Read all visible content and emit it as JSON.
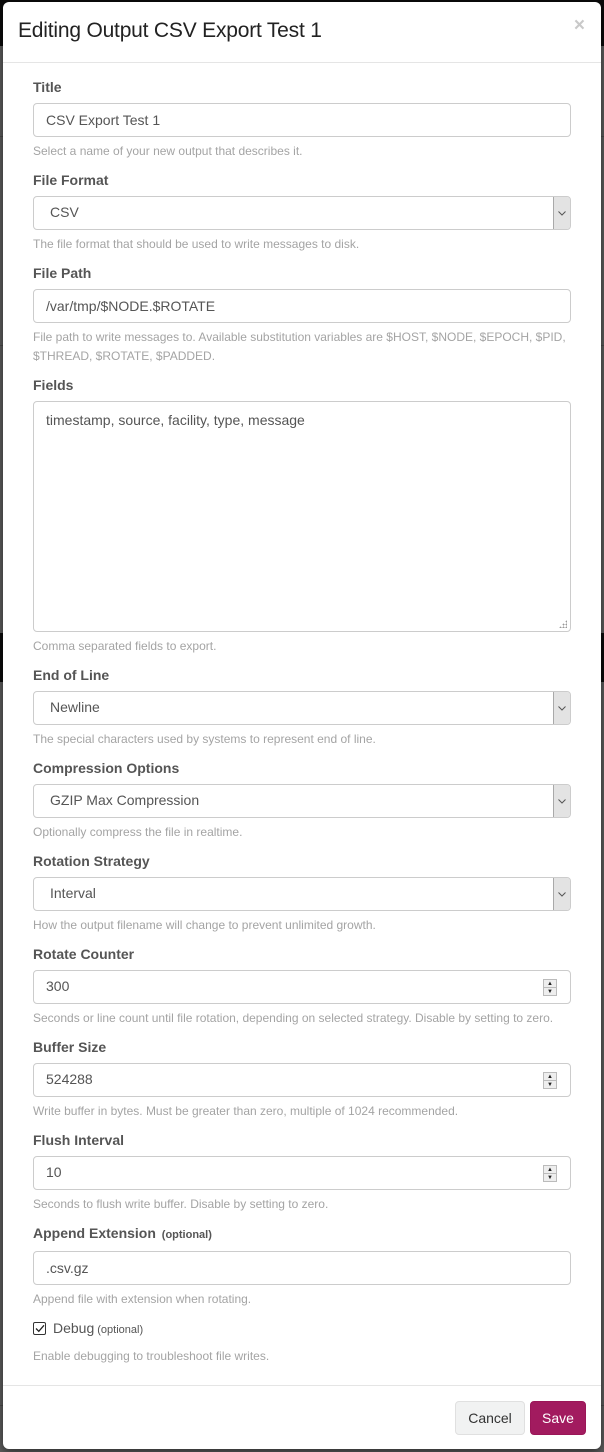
{
  "modal": {
    "title": "Editing Output CSV Export Test 1",
    "close_icon": "times-icon"
  },
  "colors": {
    "primary": "#a21b5f",
    "help_text": "#a4a4a4",
    "label": "#555555"
  },
  "fields": {
    "title": {
      "label": "Title",
      "value": "CSV Export Test 1",
      "help": "Select a name of your new output that describes it."
    },
    "file_format": {
      "label": "File Format",
      "value": "CSV",
      "help": "The file format that should be used to write messages to disk."
    },
    "file_path": {
      "label": "File Path",
      "value": "/var/tmp/$NODE.$ROTATE",
      "help": "File path to write messages to. Available substitution variables are $HOST, $NODE, $EPOCH, $PID, $THREAD, $ROTATE, $PADDED."
    },
    "fields": {
      "label": "Fields",
      "value": "timestamp, source, facility, type, message",
      "help": "Comma separated fields to export."
    },
    "end_of_line": {
      "label": "End of Line",
      "value": "Newline",
      "help": "The special characters used by systems to represent end of line."
    },
    "compression": {
      "label": "Compression Options",
      "value": "GZIP Max Compression",
      "help": "Optionally compress the file in realtime."
    },
    "rotation_strategy": {
      "label": "Rotation Strategy",
      "value": "Interval",
      "help": "How the output filename will change to prevent unlimited growth."
    },
    "rotate_counter": {
      "label": "Rotate Counter",
      "value": "300",
      "help": "Seconds or line count until file rotation, depending on selected strategy. Disable by setting to zero."
    },
    "buffer_size": {
      "label": "Buffer Size",
      "value": "524288",
      "help": "Write buffer in bytes. Must be greater than zero, multiple of 1024 recommended."
    },
    "flush_interval": {
      "label": "Flush Interval",
      "value": "10",
      "help": "Seconds to flush write buffer. Disable by setting to zero."
    },
    "append_extension": {
      "label": "Append Extension",
      "optional": "(optional)",
      "value": ".csv.gz",
      "help": "Append file with extension when rotating."
    },
    "debug": {
      "label": "Debug",
      "optional": "(optional)",
      "checked": true,
      "help": "Enable debugging to troubleshoot file writes."
    }
  },
  "footer": {
    "cancel_label": "Cancel",
    "save_label": "Save"
  }
}
